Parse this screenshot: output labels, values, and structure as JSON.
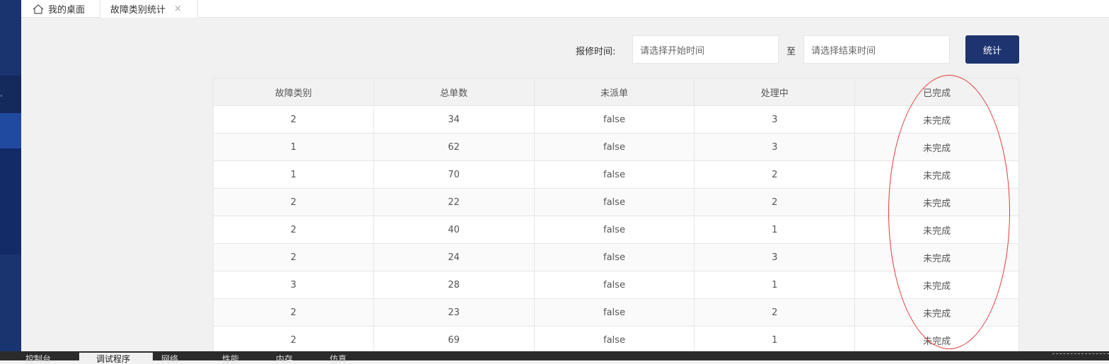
{
  "tabs": {
    "home_label": "我的桌面",
    "active_label": "故障类别统计",
    "close_glyph": "×"
  },
  "filter": {
    "label": "报修时间:",
    "start_placeholder": "请选择开始时间",
    "separator": "至",
    "end_placeholder": "请选择结束时间",
    "submit_label": "统计"
  },
  "table": {
    "headers": [
      "故障类别",
      "总单数",
      "未派单",
      "处理中",
      "已完成"
    ],
    "rows": [
      [
        "2",
        "34",
        "false",
        "3",
        "未完成"
      ],
      [
        "1",
        "62",
        "false",
        "3",
        "未完成"
      ],
      [
        "1",
        "70",
        "false",
        "2",
        "未完成"
      ],
      [
        "2",
        "22",
        "false",
        "2",
        "未完成"
      ],
      [
        "2",
        "40",
        "false",
        "1",
        "未完成"
      ],
      [
        "2",
        "24",
        "false",
        "3",
        "未完成"
      ],
      [
        "3",
        "28",
        "false",
        "1",
        "未完成"
      ],
      [
        "2",
        "23",
        "false",
        "2",
        "未完成"
      ],
      [
        "2",
        "69",
        "false",
        "1",
        "未完成"
      ]
    ]
  },
  "devtools": {
    "tabs": [
      "控制台",
      "调试程序",
      "网络",
      "性能",
      "内存",
      "仿真"
    ]
  },
  "colors": {
    "sidebar": "#1a3470",
    "button": "#1e3470",
    "annotation": "#e53935"
  },
  "icons": {
    "home": "home-icon",
    "close": "close-icon"
  }
}
